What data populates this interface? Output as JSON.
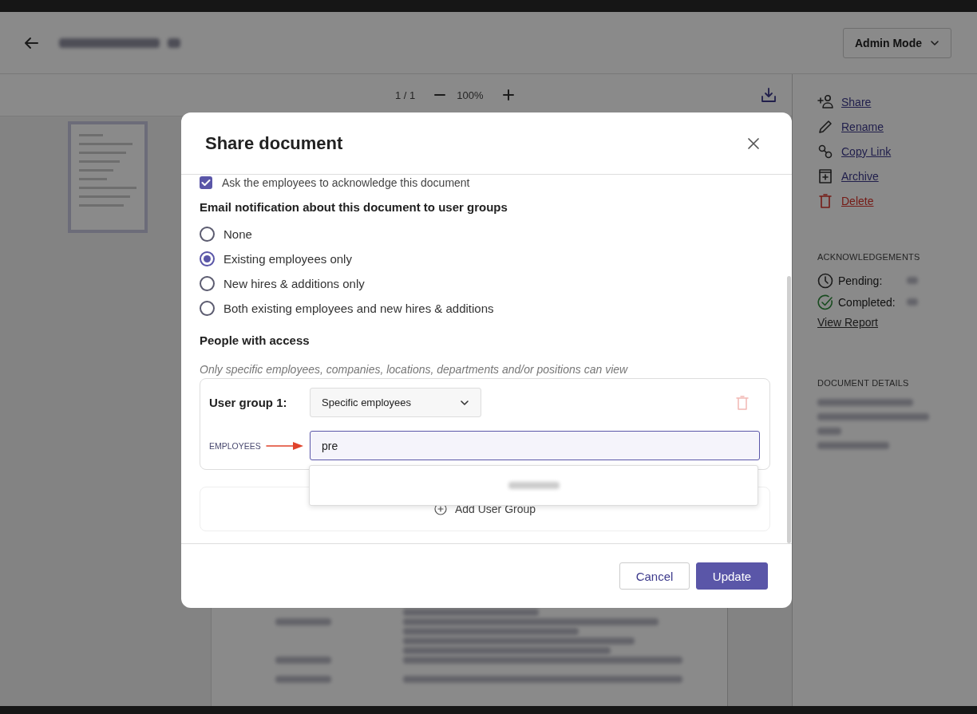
{
  "header": {
    "mode_button": "Admin Mode"
  },
  "viewer_toolbar": {
    "page": "1 / 1",
    "zoom": "100%"
  },
  "sidebar": {
    "actions": [
      {
        "label": "Share",
        "kind": "share"
      },
      {
        "label": "Rename",
        "kind": "rename"
      },
      {
        "label": "Copy Link",
        "kind": "link"
      },
      {
        "label": "Archive",
        "kind": "archive"
      },
      {
        "label": "Delete",
        "kind": "delete"
      }
    ],
    "acknowledgements": {
      "heading": "ACKNOWLEDGEMENTS",
      "items": [
        {
          "label": "Pending:",
          "kind": "pending"
        },
        {
          "label": "Completed:",
          "kind": "completed"
        }
      ],
      "link": "View Report"
    },
    "details": {
      "heading": "DOCUMENT DETAILS"
    }
  },
  "dialog": {
    "title": "Share document",
    "acknowledge": {
      "label": "Ask the employees to acknowledge this document",
      "checked": true
    },
    "email": {
      "heading": "Email notification about this document to user groups",
      "options": [
        {
          "label": "None",
          "selected": false
        },
        {
          "label": "Existing employees only",
          "selected": true
        },
        {
          "label": "New hires & additions only",
          "selected": false
        },
        {
          "label": "Both existing employees and new hires & additions",
          "selected": false
        }
      ]
    },
    "access": {
      "heading": "People with access",
      "hint": "Only specific employees, companies, locations, departments and/or positions can view"
    },
    "user_groups": [
      {
        "label": "User group 1:",
        "type": "Specific employees",
        "field_label": "EMPLOYEES",
        "value": "pre"
      }
    ],
    "add_group": "Add User Group",
    "buttons": [
      {
        "label": "Cancel",
        "kind": "secondary"
      },
      {
        "label": "Update",
        "kind": "primary"
      }
    ]
  }
}
